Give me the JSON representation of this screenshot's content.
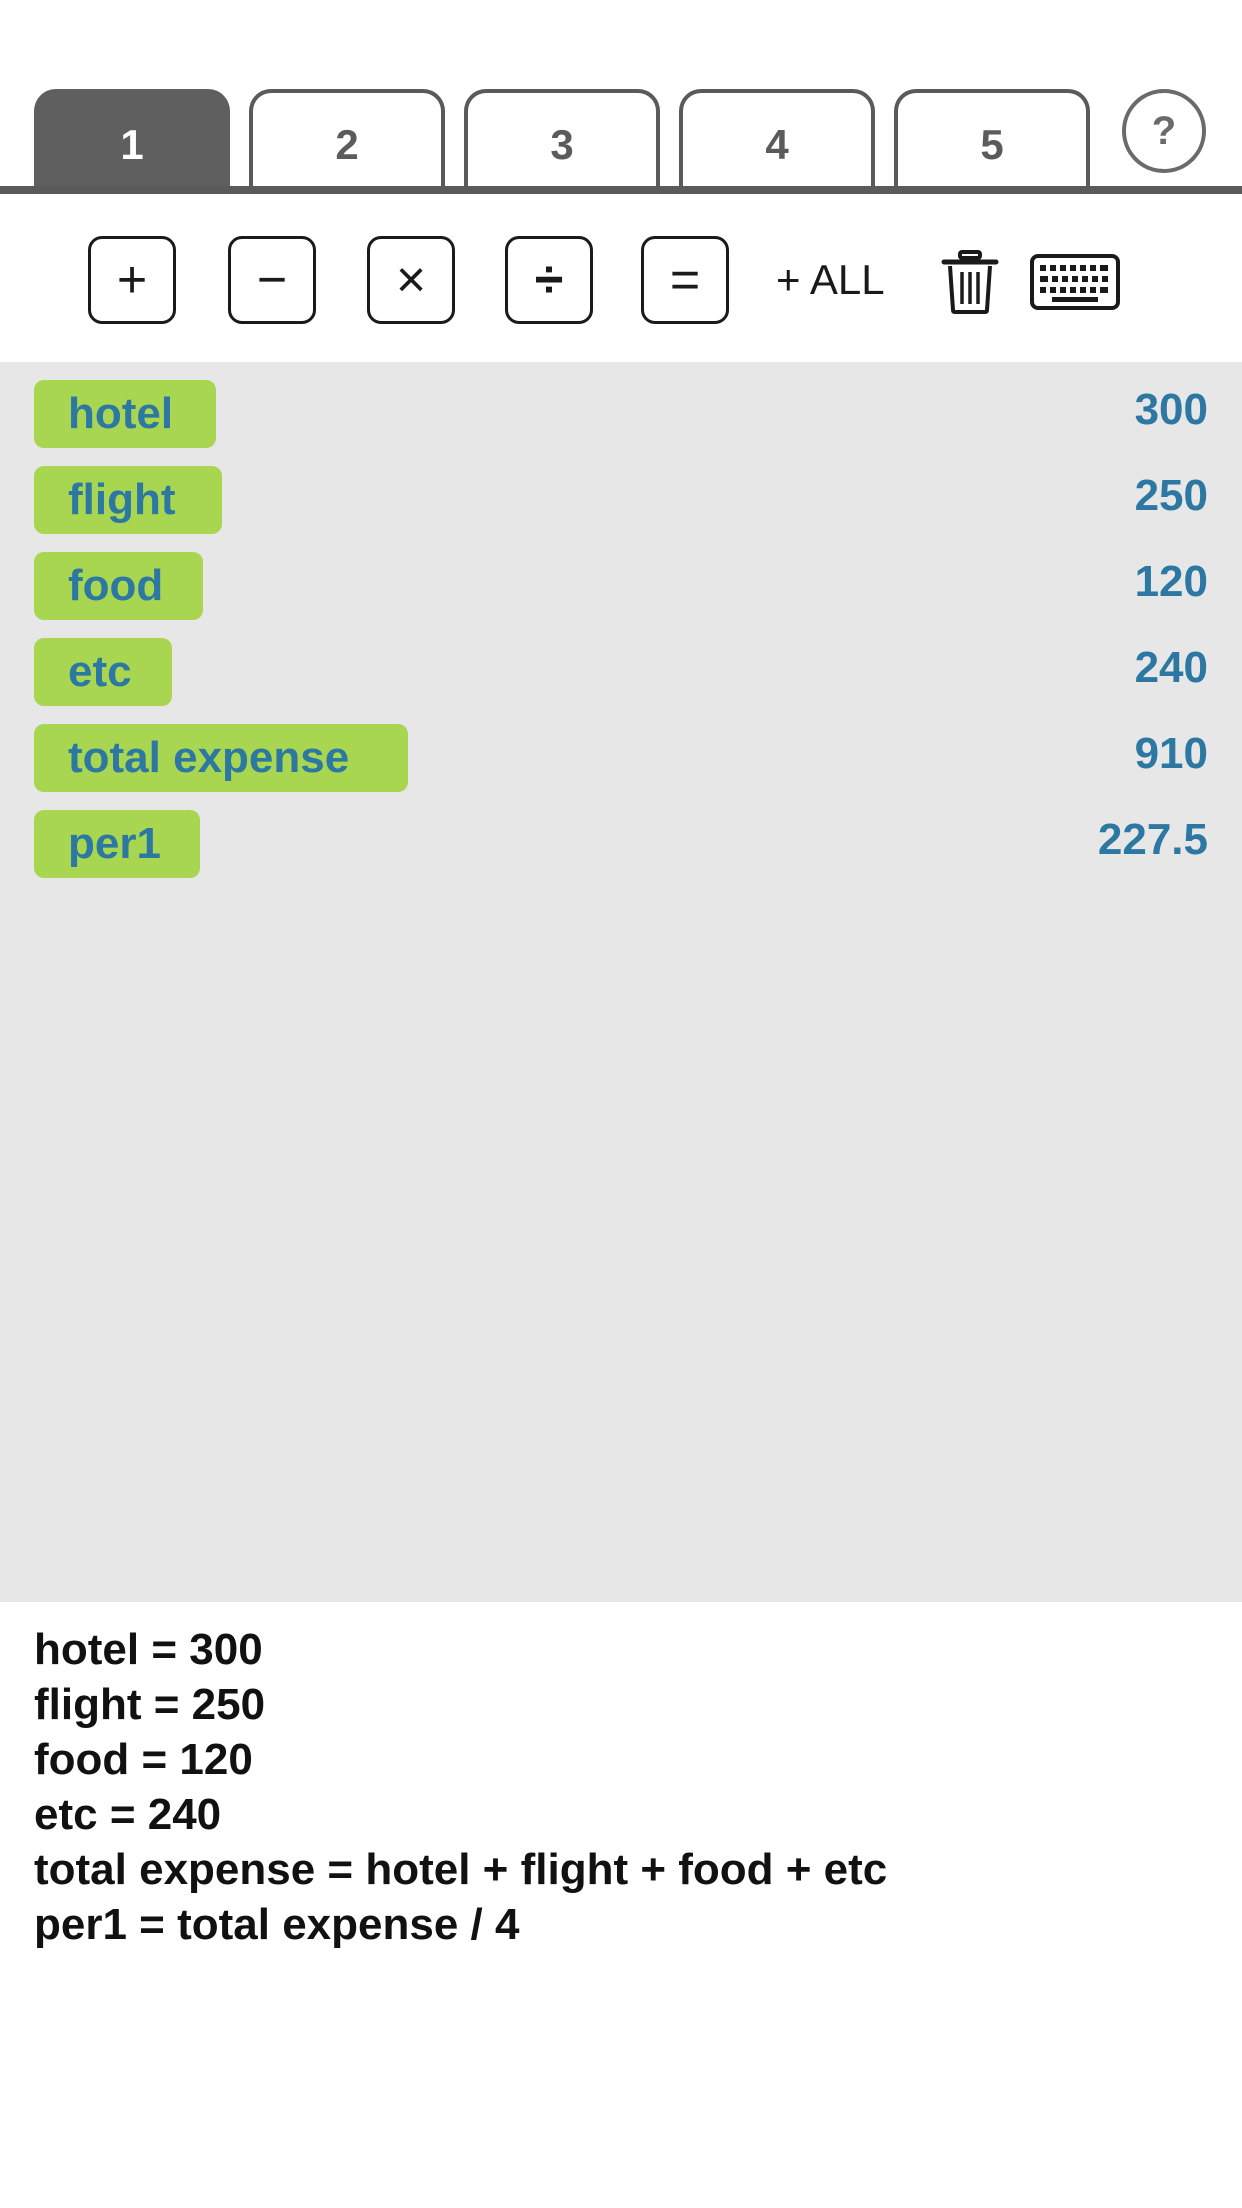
{
  "tabs": [
    {
      "label": "1",
      "active": true
    },
    {
      "label": "2",
      "active": false
    },
    {
      "label": "3",
      "active": false
    },
    {
      "label": "4",
      "active": false
    },
    {
      "label": "5",
      "active": false
    }
  ],
  "help": {
    "label": "?"
  },
  "toolbar": {
    "plus": "+",
    "minus": "−",
    "times": "×",
    "divide": "÷",
    "equals": "=",
    "plus_all": "+ ALL",
    "trash_icon": "trash-icon",
    "keyboard_icon": "keyboard-icon"
  },
  "colors": {
    "chip_bg": "#a8d650",
    "value_text": "#2c78a3",
    "active_tab": "#5f5f5f",
    "list_bg": "#e7e7e7"
  },
  "rows": [
    {
      "name": "hotel",
      "value": "300"
    },
    {
      "name": "flight",
      "value": "250"
    },
    {
      "name": "food",
      "value": "120"
    },
    {
      "name": "etc",
      "value": "240"
    },
    {
      "name": "total expense",
      "value": "910"
    },
    {
      "name": "per1",
      "value": "227.5"
    }
  ],
  "formulas": [
    "hotel = 300",
    "flight = 250",
    "food = 120",
    "etc = 240",
    "total expense = hotel + flight + food + etc",
    "per1 = total expense / 4"
  ]
}
